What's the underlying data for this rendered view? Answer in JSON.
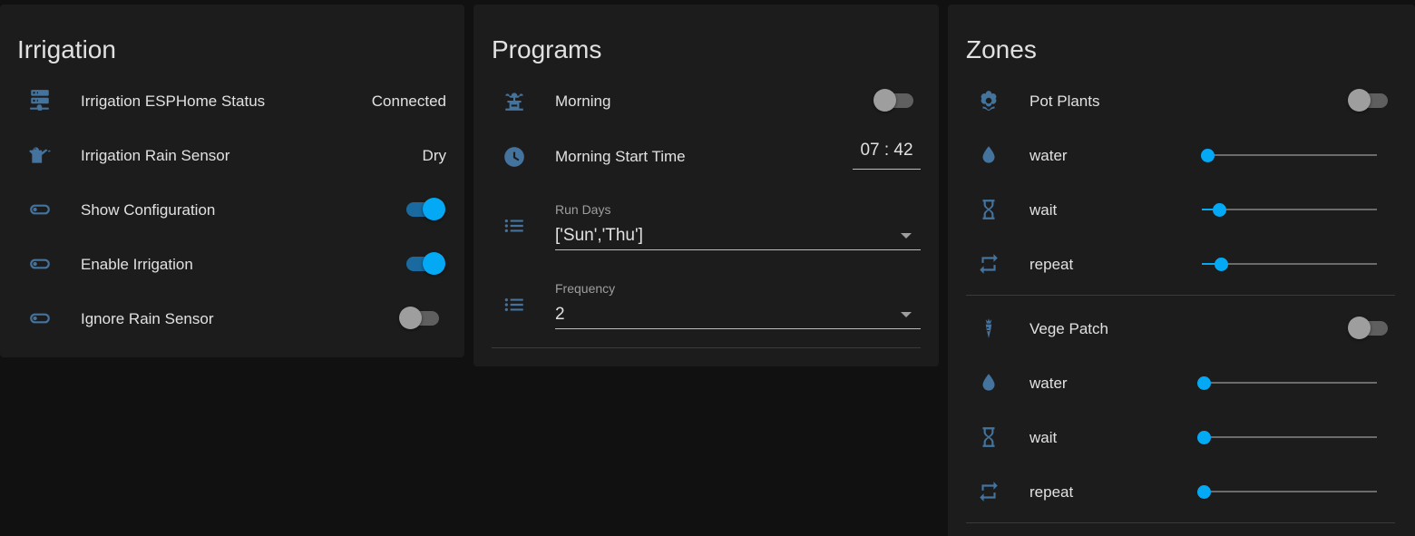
{
  "irrigation": {
    "title": "Irrigation",
    "rows": [
      {
        "icon": "server-network-icon",
        "label": "Irrigation ESPHome Status",
        "value": "Connected"
      },
      {
        "icon": "watering-can-icon",
        "label": "Irrigation Rain Sensor",
        "value": "Dry"
      },
      {
        "icon": "toggle-switch-icon",
        "label": "Show Configuration",
        "toggle": "on"
      },
      {
        "icon": "toggle-switch-icon",
        "label": "Enable Irrigation",
        "toggle": "on"
      },
      {
        "icon": "toggle-switch-icon",
        "label": "Ignore Rain Sensor",
        "toggle": "off"
      }
    ]
  },
  "programs": {
    "title": "Programs",
    "morning": {
      "icon": "fountain-icon",
      "label": "Morning",
      "toggle": "off"
    },
    "start_time": {
      "icon": "clock-icon",
      "label": "Morning Start Time",
      "hour": "07",
      "separator": ":",
      "minute": "42"
    },
    "run_days": {
      "icon": "format-list-bulleted-icon",
      "caption": "Run Days",
      "value": "['Sun','Thu']"
    },
    "frequency": {
      "icon": "format-list-bulleted-icon",
      "caption": "Frequency",
      "value": "2"
    }
  },
  "zones": {
    "title": "Zones",
    "groups": [
      {
        "name": "Pot Plants",
        "icon": "flower-icon",
        "toggle": "off",
        "sliders": [
          {
            "icon": "water-drop-icon",
            "label": "water",
            "level": 0.03
          },
          {
            "icon": "hourglass-icon",
            "label": "wait",
            "level": 0.1
          },
          {
            "icon": "repeat-icon",
            "label": "repeat",
            "level": 0.11
          }
        ]
      },
      {
        "name": "Vege Patch",
        "icon": "carrot-icon",
        "toggle": "off",
        "sliders": [
          {
            "icon": "water-drop-icon",
            "label": "water",
            "level": 0.0
          },
          {
            "icon": "hourglass-icon",
            "label": "wait",
            "level": 0.0
          },
          {
            "icon": "repeat-icon",
            "label": "repeat",
            "level": 0.0
          }
        ]
      }
    ]
  },
  "colors": {
    "background": "#111111",
    "card": "#1c1c1c",
    "icon": "#44739e",
    "accent": "#03a9f4",
    "text": "#e1e1e1"
  }
}
